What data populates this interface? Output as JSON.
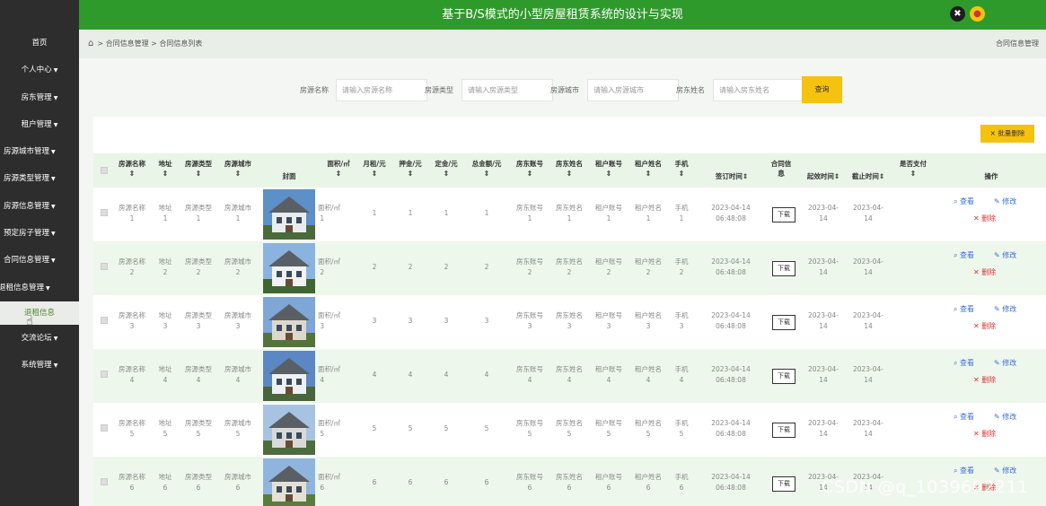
{
  "header": {
    "title": "基于B/S模式的小型房屋租赁系统的设计与实现",
    "gear_icon": "settings-icon",
    "user_icon": "user-icon",
    "accent": "#2f9a2c"
  },
  "sidebar": {
    "items": [
      {
        "label": "首页",
        "arrow": ""
      },
      {
        "label": "个人中心",
        "arrow": "▼"
      },
      {
        "label": "房东管理",
        "arrow": "▼"
      },
      {
        "label": "租户管理",
        "arrow": "▼"
      },
      {
        "label": "房源城市管理",
        "arrow": "▼"
      },
      {
        "label": "房源类型管理",
        "arrow": "▼"
      },
      {
        "label": "房源信息管理",
        "arrow": "▼"
      },
      {
        "label": "预定房子管理",
        "arrow": "▼"
      },
      {
        "label": "合同信息管理",
        "arrow": "▼"
      },
      {
        "label": "退租信息管理",
        "arrow": "▼"
      },
      {
        "label": "退租信息",
        "arrow": ""
      },
      {
        "label": "交流论坛",
        "arrow": "▼"
      },
      {
        "label": "系统管理",
        "arrow": "▼"
      }
    ]
  },
  "breadcrumb": {
    "path": "> 合同信息管理 > 合同信息列表",
    "right": "合同信息管理"
  },
  "search": {
    "fields": [
      {
        "label": "房源名称",
        "placeholder": "请输入房源名称"
      },
      {
        "label": "房源类型",
        "placeholder": "请输入房源类型"
      },
      {
        "label": "房源城市",
        "placeholder": "请输入房源城市"
      },
      {
        "label": "房东姓名",
        "placeholder": "请输入房东姓名"
      }
    ],
    "button": "查询"
  },
  "table": {
    "batch_delete": "× 批量删除",
    "headers": {
      "name": "房源名称",
      "addr": "地址",
      "type": "房源类型",
      "city": "房源城市",
      "cover": "封面",
      "area": "面积/㎡",
      "rent": "月租/元",
      "deposit": "押金/元",
      "earnest": "定金/元",
      "total": "总金额/元",
      "landlord_acct": "房东账号",
      "landlord_name": "房东姓名",
      "tenant_acct": "租户账号",
      "tenant_name": "租户姓名",
      "phone": "手机",
      "sign_time": "签订时间⇕",
      "contract_a": "合同信",
      "contract_b": "息",
      "start": "起效时间⇕",
      "end": "截止时间⇕",
      "paid": "是否支付",
      "ops": "操作",
      "sort": "⇕"
    },
    "rows": [
      {
        "n": "1",
        "date": "2023-04-14",
        "time": "06:48:08",
        "d1": "2023-04-",
        "d2": "14",
        "d3": "2023-04-",
        "d4": "14"
      },
      {
        "n": "2",
        "date": "2023-04-14",
        "time": "06:48:08",
        "d1": "2023-04-",
        "d2": "14",
        "d3": "2023-04-",
        "d4": "14"
      },
      {
        "n": "3",
        "date": "2023-04-14",
        "time": "06:48:08",
        "d1": "2023-04-",
        "d2": "14",
        "d3": "2023-04-",
        "d4": "14"
      },
      {
        "n": "4",
        "date": "2023-04-14",
        "time": "06:48:08",
        "d1": "2023-04-",
        "d2": "14",
        "d3": "2023-04-",
        "d4": "14"
      },
      {
        "n": "5",
        "date": "2023-04-14",
        "time": "06:48:08",
        "d1": "2023-04-",
        "d2": "14",
        "d3": "2023-04-",
        "d4": "14"
      },
      {
        "n": "6",
        "date": "2023-04-14",
        "time": "06:48:08",
        "d1": "2023-04-",
        "d2": "14",
        "d3": "2023-04-",
        "d4": "14"
      }
    ],
    "labels": {
      "name": "房源名称",
      "addr": "地址",
      "type": "房源类型",
      "city": "房源城市",
      "area": "面积/㎡",
      "landlord_acct": "房东账号",
      "landlord_name": "房东姓名",
      "tenant_acct": "租户账号",
      "tenant_name": "租户姓名",
      "phone": "手机",
      "download": "下载",
      "view": "查看",
      "edit": "修改",
      "del": "删除"
    }
  },
  "watermark": "CSDN @q_1039692211"
}
